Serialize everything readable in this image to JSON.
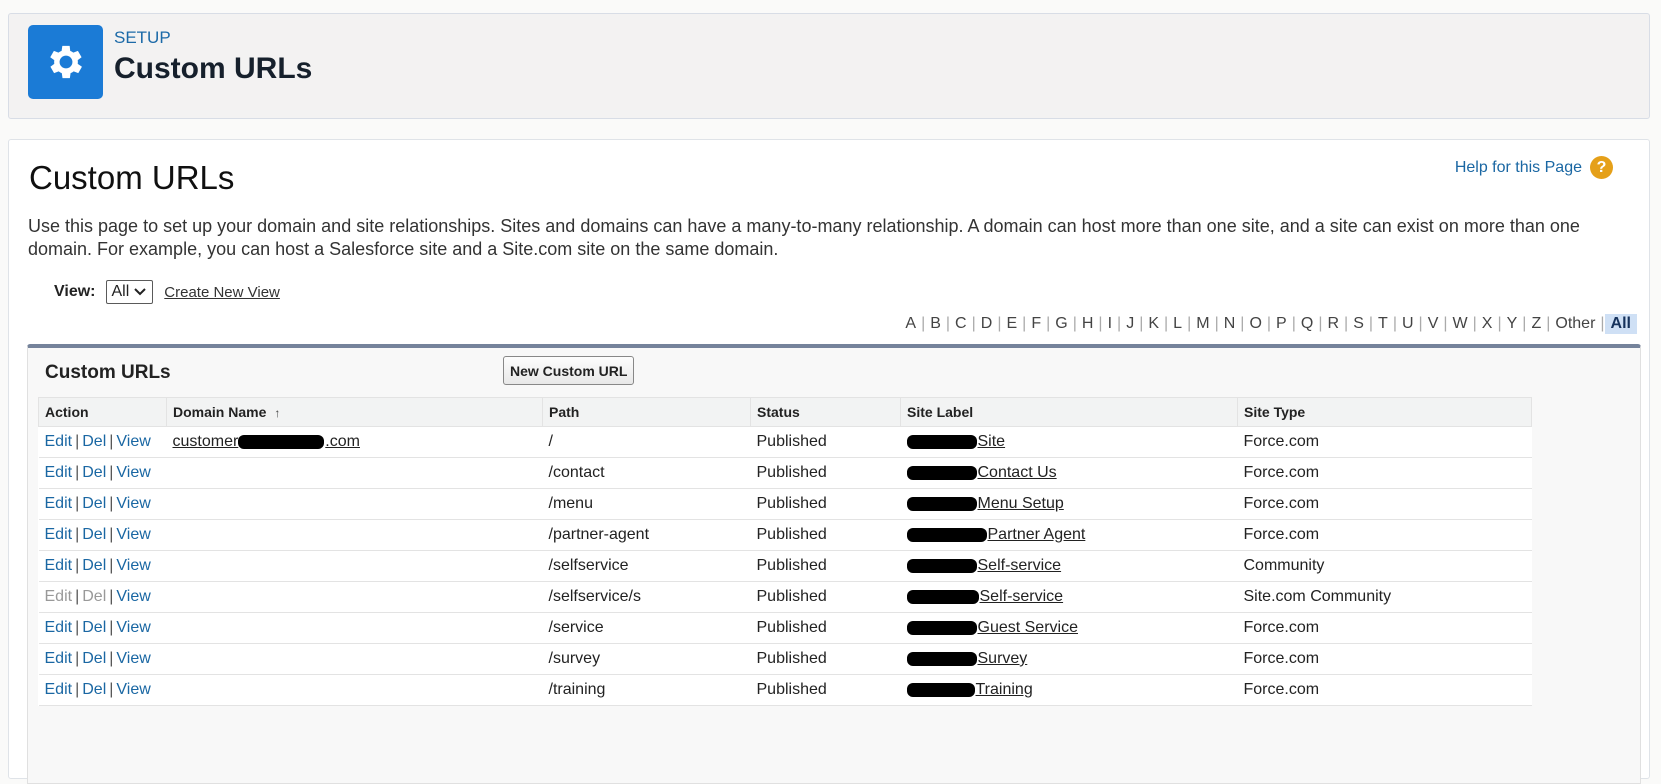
{
  "header": {
    "eyebrow": "SETUP",
    "title": "Custom URLs",
    "icon": "gear-icon"
  },
  "page": {
    "title": "Custom URLs",
    "help_link": "Help for this Page",
    "help_icon": "?",
    "description": "Use this page to set up your domain and site relationships. Sites and domains can have a many-to-many relationship. A domain can host more than one site, and a site can exist on more than one domain. For example, you can host a Salesforce site and a Site.com site on the same domain."
  },
  "view": {
    "label": "View:",
    "selected": "All",
    "create_link": "Create New View"
  },
  "alphabet": [
    "A",
    "B",
    "C",
    "D",
    "E",
    "F",
    "G",
    "H",
    "I",
    "J",
    "K",
    "L",
    "M",
    "N",
    "O",
    "P",
    "Q",
    "R",
    "S",
    "T",
    "U",
    "V",
    "W",
    "X",
    "Y",
    "Z",
    "Other",
    "All"
  ],
  "related_list": {
    "title": "Custom URLs",
    "new_button": "New Custom URL",
    "columns": [
      "Action",
      "Domain Name",
      "Path",
      "Status",
      "Site Label",
      "Site Type"
    ],
    "sort_indicator": "↑",
    "rows": [
      {
        "actions": [
          "Edit",
          "Del",
          "View"
        ],
        "disabled": false,
        "domain_pre": "customer",
        "domain_post": ".com",
        "path": "/",
        "status": "Published",
        "site_label": "Site",
        "site_type": "Force.com"
      },
      {
        "actions": [
          "Edit",
          "Del",
          "View"
        ],
        "disabled": false,
        "domain_pre": "",
        "domain_post": "",
        "path": "/contact",
        "status": "Published",
        "site_label": "Contact Us",
        "site_type": "Force.com"
      },
      {
        "actions": [
          "Edit",
          "Del",
          "View"
        ],
        "disabled": false,
        "domain_pre": "",
        "domain_post": "",
        "path": "/menu",
        "status": "Published",
        "site_label": "Menu Setup",
        "site_type": "Force.com"
      },
      {
        "actions": [
          "Edit",
          "Del",
          "View"
        ],
        "disabled": false,
        "domain_pre": "",
        "domain_post": "",
        "path": "/partner-agent",
        "status": "Published",
        "site_label": "Partner Agent",
        "site_type": "Force.com"
      },
      {
        "actions": [
          "Edit",
          "Del",
          "View"
        ],
        "disabled": false,
        "domain_pre": "",
        "domain_post": "",
        "path": "/selfservice",
        "status": "Published",
        "site_label": "Self-service",
        "site_type": "Community"
      },
      {
        "actions": [
          "Edit",
          "Del",
          "View"
        ],
        "disabled": true,
        "domain_pre": "",
        "domain_post": "",
        "path": "/selfservice/s",
        "status": "Published",
        "site_label": "Self-service",
        "site_type": "Site.com Community"
      },
      {
        "actions": [
          "Edit",
          "Del",
          "View"
        ],
        "disabled": false,
        "domain_pre": "",
        "domain_post": "",
        "path": "/service",
        "status": "Published",
        "site_label": "Guest Service",
        "site_type": "Force.com"
      },
      {
        "actions": [
          "Edit",
          "Del",
          "View"
        ],
        "disabled": false,
        "domain_pre": "",
        "domain_post": "",
        "path": "/survey",
        "status": "Published",
        "site_label": "Survey",
        "site_type": "Force.com"
      },
      {
        "actions": [
          "Edit",
          "Del",
          "View"
        ],
        "disabled": false,
        "domain_pre": "",
        "domain_post": "",
        "path": "/training",
        "status": "Published",
        "site_label": "Training",
        "site_type": "Force.com"
      }
    ]
  }
}
